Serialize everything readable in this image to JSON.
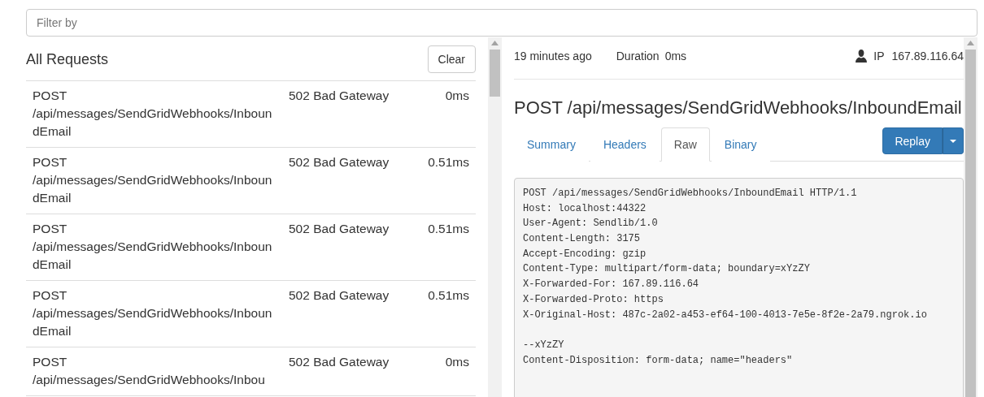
{
  "filter": {
    "placeholder": "Filter by"
  },
  "requests": {
    "title": "All Requests",
    "clear_button": "Clear",
    "rows": [
      {
        "method": "POST",
        "path": "/api/messages/SendGridWebhooks/InboundEmail",
        "status": "502 Bad Gateway",
        "duration": "0ms"
      },
      {
        "method": "POST",
        "path": "/api/messages/SendGridWebhooks/InboundEmail",
        "status": "502 Bad Gateway",
        "duration": "0.51ms"
      },
      {
        "method": "POST",
        "path": "/api/messages/SendGridWebhooks/InboundEmail",
        "status": "502 Bad Gateway",
        "duration": "0.51ms"
      },
      {
        "method": "POST",
        "path": "/api/messages/SendGridWebhooks/InboundEmail",
        "status": "502 Bad Gateway",
        "duration": "0.51ms"
      },
      {
        "method": "POST",
        "path": "/api/messages/SendGridWebhooks/Inbou",
        "status": "502 Bad Gateway",
        "duration": "0ms"
      }
    ]
  },
  "detail": {
    "time": "19 minutes ago",
    "duration_label": "Duration",
    "duration": "0ms",
    "ip_label": "IP",
    "ip": "167.89.116.64",
    "heading": "POST /api/messages/SendGridWebhooks/InboundEmail",
    "tabs": [
      {
        "label": "Summary",
        "selected": false
      },
      {
        "label": "Headers",
        "selected": false
      },
      {
        "label": "Raw",
        "selected": true
      },
      {
        "label": "Binary",
        "selected": false
      }
    ],
    "replay_button": "Replay",
    "raw_head": [
      "POST /api/messages/SendGridWebhooks/InboundEmail HTTP/1.1",
      "Host: localhost:44322",
      "User-Agent: Sendlib/1.0",
      "Content-Length: 3175",
      "Accept-Encoding: gzip",
      "Content-Type: multipart/form-data; boundary=xYzZY",
      "X-Forwarded-For: 167.89.116.64",
      "X-Forwarded-Proto: https",
      "X-Original-Host: 487c-2a02-a453-ef64-100-4013-7e5e-8f2e-2a79.ngrok.io"
    ],
    "raw_body": [
      "--xYzZY",
      "Content-Disposition: form-data; name=\"headers\""
    ]
  }
}
